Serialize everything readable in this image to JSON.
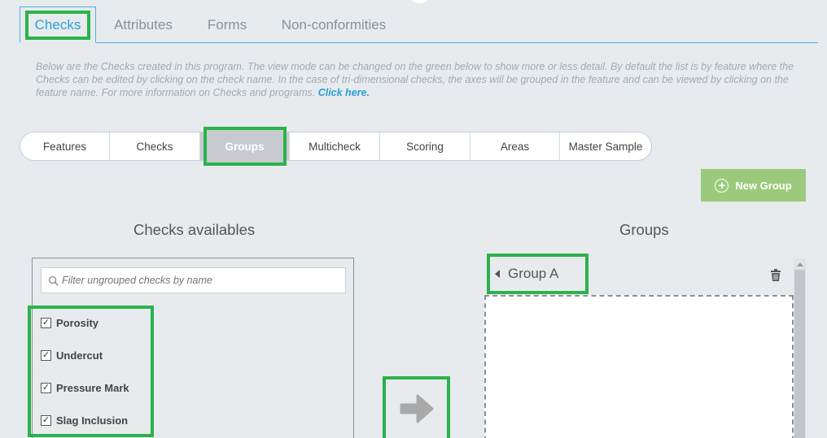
{
  "main_tabs": [
    {
      "label": "Checks",
      "active": true
    },
    {
      "label": "Attributes"
    },
    {
      "label": "Forms"
    },
    {
      "label": "Non-conformities"
    }
  ],
  "description": {
    "text": "Below are the Checks created in this program. The view mode can be changed on the green below to show more or less detail. By default the list is by feature where the Checks can be edited by clicking on the check name. In the case of tri-dimensional checks, the axes will be grouped in the feature and can be viewed by clicking on the feature name. For more information on Checks and programs.",
    "link": "Click here."
  },
  "view_modes": [
    {
      "label": "Features"
    },
    {
      "label": "Checks"
    },
    {
      "label": "Groups",
      "active": true
    },
    {
      "label": "Multicheck"
    },
    {
      "label": "Scoring"
    },
    {
      "label": "Areas"
    },
    {
      "label": "Master Sample"
    }
  ],
  "new_group_label": "New Group",
  "checks_panel": {
    "title": "Checks availables",
    "filter_placeholder": "Filter ungrouped checks by name",
    "items": [
      {
        "label": "Porosity",
        "checked": true
      },
      {
        "label": "Undercut",
        "checked": true
      },
      {
        "label": "Pressure Mark",
        "checked": true
      },
      {
        "label": "Slag Inclusion",
        "checked": true
      }
    ]
  },
  "groups_panel": {
    "title": "Groups",
    "groups": [
      {
        "name": "Group A"
      }
    ]
  },
  "colors": {
    "accent": "#2a9fd8",
    "highlight": "#2bb24c",
    "new_group_bg": "#9cca7c",
    "background": "#e8ebee"
  },
  "icons": {
    "filter": "search-icon",
    "new_group": "plus-circle-icon",
    "move": "arrow-right-icon",
    "delete": "trash-icon",
    "group_toggle": "caret-left-icon"
  }
}
